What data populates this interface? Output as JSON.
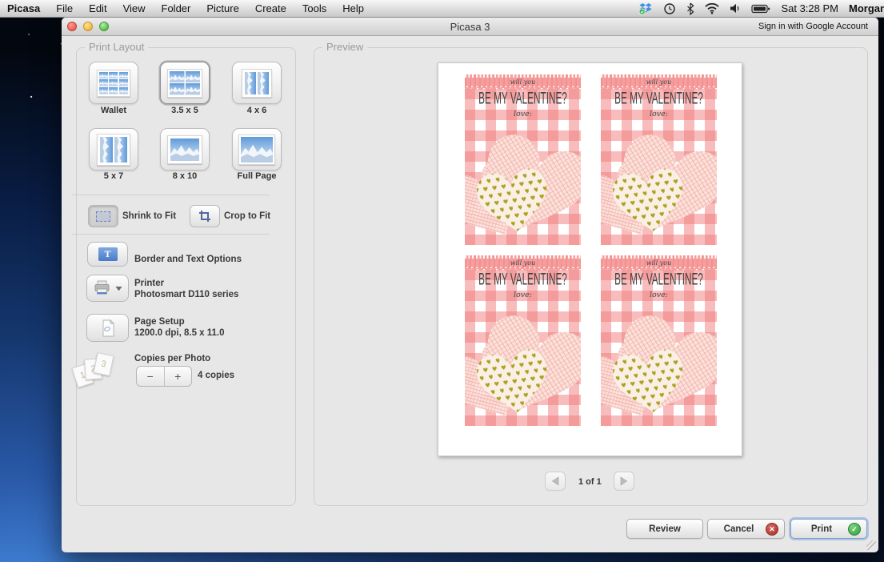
{
  "menu_bar": {
    "app": "Picasa",
    "items": [
      "File",
      "Edit",
      "View",
      "Folder",
      "Picture",
      "Create",
      "Tools",
      "Help"
    ],
    "status": {
      "time": "Sat 3:28 PM",
      "user": "Morgan"
    }
  },
  "window": {
    "title": "Picasa 3",
    "signin": "Sign in with Google Account"
  },
  "print_layout": {
    "legend": "Print Layout",
    "layouts": [
      {
        "label": "Wallet"
      },
      {
        "label": "3.5 x 5"
      },
      {
        "label": "4 x 6"
      },
      {
        "label": "5 x 7"
      },
      {
        "label": "8 x 10"
      },
      {
        "label": "Full Page"
      }
    ],
    "selected_layout": "3.5 x 5",
    "shrink_label": "Shrink to Fit",
    "crop_label": "Crop to Fit",
    "border_text_label": "Border and Text Options",
    "printer_label": "Printer",
    "printer_value": "Photosmart D110 series",
    "page_setup_label": "Page Setup",
    "page_setup_value": "1200.0 dpi, 8.5 x 11.0",
    "copies_label": "Copies per Photo",
    "copies_value": "4 copies",
    "minus": "−",
    "plus": "+"
  },
  "preview": {
    "legend": "Preview",
    "page_indicator": "1 of 1",
    "card": {
      "line1": "will you",
      "line2": "BE MY VALENTINE?",
      "line3": "love:"
    }
  },
  "footer": {
    "review": "Review",
    "cancel": "Cancel",
    "print": "Print",
    "cancel_x": "✕",
    "print_check": "✓"
  }
}
